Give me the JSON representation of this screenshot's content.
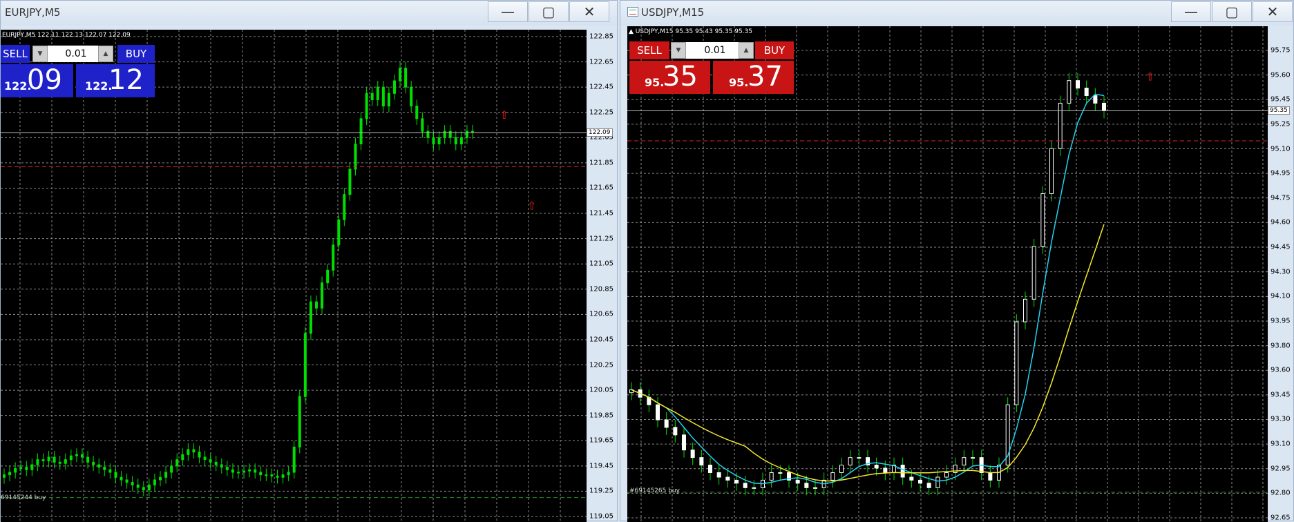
{
  "left": {
    "title": "EURJPY,M5",
    "header": "EURJPY,M5  122.11 122.13 122.07 122.09",
    "sell": "SELL",
    "buy": "BUY",
    "lot": "0.01",
    "bid_small": "122.",
    "bid_big": "09",
    "ask_small": "122.",
    "ask_big": "12",
    "order_label": "69145244 buy",
    "current_price": "122.09",
    "price_ticks": [
      "122.85",
      "122.65",
      "122.45",
      "122.25",
      "122.05",
      "121.85",
      "121.65",
      "121.45",
      "121.25",
      "121.05",
      "120.85",
      "120.65",
      "120.45",
      "120.25",
      "120.05",
      "119.85",
      "119.65",
      "119.45",
      "119.25",
      "119.05"
    ],
    "panel_color": "#1f22c9"
  },
  "right": {
    "title": "USDJPY,M15",
    "header": "USDJPY,M15  95.35 95.43 95.35 95.35",
    "sell": "SELL",
    "buy": "BUY",
    "lot": "0.01",
    "bid_small": "95.",
    "bid_big": "35",
    "ask_small": "95.",
    "ask_big": "37",
    "order_label": "#69145265 buy",
    "current_price": "95.35",
    "price_ticks": [
      "95.75",
      "95.60",
      "95.45",
      "95.25",
      "95.10",
      "94.95",
      "94.75",
      "94.60",
      "94.45",
      "94.30",
      "94.10",
      "93.95",
      "93.80",
      "93.60",
      "93.45",
      "93.30",
      "93.10",
      "92.95",
      "92.80",
      "92.65"
    ],
    "panel_color": "#c81414"
  },
  "window_buttons": {
    "minimize": "—",
    "maximize": "▢",
    "close": "✕"
  },
  "colors": {
    "candle": "#00e000",
    "grid": "#8a8a8a",
    "ma_fast": "#22d3ee",
    "ma_slow": "#f5e82a",
    "stop_line": "#d22",
    "order_line": "#2a8a2a"
  },
  "chart_data": [
    {
      "type": "candlestick",
      "title": "EURJPY,M5",
      "ylim": [
        119.05,
        122.85
      ],
      "series": [
        {
          "name": "EURJPY",
          "close": [
            119.38,
            119.4,
            119.43,
            119.44,
            119.42,
            119.46,
            119.5,
            119.49,
            119.52,
            119.48,
            119.47,
            119.5,
            119.53,
            119.54,
            119.52,
            119.48,
            119.46,
            119.44,
            119.42,
            119.4,
            119.36,
            119.34,
            119.32,
            119.3,
            119.28,
            119.26,
            119.3,
            119.34,
            119.36,
            119.4,
            119.45,
            119.5,
            119.54,
            119.58,
            119.56,
            119.52,
            119.5,
            119.48,
            119.46,
            119.44,
            119.42,
            119.4,
            119.4,
            119.41,
            119.42,
            119.4,
            119.38,
            119.38,
            119.37,
            119.36,
            119.38,
            119.4,
            119.6,
            120.0,
            120.5,
            120.75,
            120.7,
            120.9,
            121.0,
            121.2,
            121.4,
            121.6,
            121.8,
            122.0,
            122.2,
            122.4,
            122.35,
            122.45,
            122.3,
            122.4,
            122.5,
            122.6,
            122.45,
            122.3,
            122.2,
            122.1,
            122.05,
            122.0,
            122.05,
            122.1,
            122.05,
            122.0,
            122.05,
            122.1,
            122.09
          ]
        }
      ]
    },
    {
      "type": "candlestick",
      "title": "USDJPY,M15",
      "ylim": [
        92.65,
        95.75
      ],
      "series": [
        {
          "name": "USDJPY",
          "close": [
            93.5,
            93.45,
            93.4,
            93.3,
            93.25,
            93.2,
            93.1,
            93.05,
            93.0,
            92.95,
            92.92,
            92.9,
            92.88,
            92.85,
            92.85,
            92.9,
            92.95,
            92.95,
            92.9,
            92.88,
            92.85,
            92.85,
            92.9,
            92.95,
            93.0,
            93.05,
            93.05,
            93.0,
            92.98,
            92.95,
            93.0,
            92.92,
            92.9,
            92.88,
            92.85,
            92.92,
            92.95,
            93.0,
            93.05,
            93.05,
            92.95,
            92.9,
            93.0,
            93.4,
            93.95,
            94.1,
            94.45,
            94.8,
            95.1,
            95.4,
            95.55,
            95.5,
            95.45,
            95.4,
            95.35
          ]
        },
        {
          "name": "MA fast"
        },
        {
          "name": "MA slow"
        }
      ]
    }
  ]
}
